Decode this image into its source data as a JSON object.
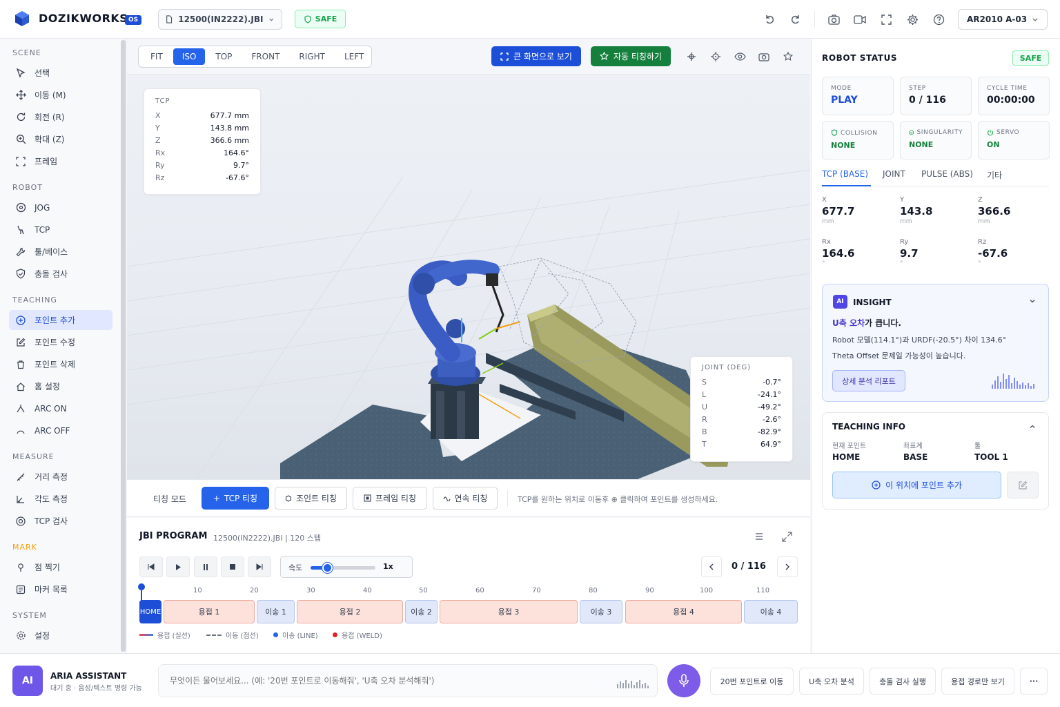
{
  "app": {
    "brand": "DOZIKWORKS",
    "os_badge": "OS",
    "file_name": "12500(IN2222).JBI",
    "safety": "SAFE",
    "robot_model": "AR2010 A-03"
  },
  "sidebar": {
    "sections": {
      "scene": "SCENE",
      "robot": "ROBOT",
      "teaching": "TEACHING",
      "measure": "MEASURE",
      "mark": "MARK",
      "system": "SYSTEM"
    },
    "scene_items": [
      "선택",
      "이동 (M)",
      "회전 (R)",
      "확대 (Z)",
      "프레임"
    ],
    "robot_items": [
      "JOG",
      "TCP",
      "툴/베이스",
      "충돌 검사"
    ],
    "teaching_items": [
      "포인트 추가",
      "포인트 수정",
      "포인트 삭제",
      "홈 설정",
      "ARC ON",
      "ARC OFF"
    ],
    "measure_items": [
      "거리 측정",
      "각도 측정",
      "TCP 검사"
    ],
    "mark_items": [
      "점 찍기",
      "마커 목록"
    ],
    "system_items": [
      "설정"
    ]
  },
  "viewport": {
    "view_tabs": [
      "FIT",
      "ISO",
      "TOP",
      "FRONT",
      "RIGHT",
      "LEFT"
    ],
    "active_view": "ISO",
    "fullscreen_label": "큰 화면으로 보기",
    "auto_teach_label": "자동 티칭하기",
    "tcp_card": {
      "title": "TCP",
      "rows": [
        {
          "k": "X",
          "v": "677.7 mm"
        },
        {
          "k": "Y",
          "v": "143.8 mm"
        },
        {
          "k": "Z",
          "v": "366.6 mm"
        },
        {
          "k": "Rx",
          "v": "164.6°"
        },
        {
          "k": "Ry",
          "v": "9.7°"
        },
        {
          "k": "Rz",
          "v": "-67.6°"
        }
      ]
    },
    "joint_card": {
      "title": "JOINT (DEG)",
      "rows": [
        {
          "k": "S",
          "v": "-0.7°"
        },
        {
          "k": "L",
          "v": "-24.1°"
        },
        {
          "k": "U",
          "v": "-49.2°"
        },
        {
          "k": "R",
          "v": "-2.6°"
        },
        {
          "k": "B",
          "v": "-82.9°"
        },
        {
          "k": "T",
          "v": "64.9°"
        }
      ]
    }
  },
  "teach_bar": {
    "label": "티칭 모드",
    "buttons": [
      "TCP 티칭",
      "조인트 티칭",
      "프레임 티칭",
      "연속 티칭"
    ],
    "hint": "TCP를 원하는 위치로 이동후 ⊕ 클릭하여 포인트를 생성하세요."
  },
  "program": {
    "title": "JBI PROGRAM",
    "subtitle": "12500(IN2222).JBI | 120 스텝",
    "speed_label": "속도",
    "speed_value": "1x",
    "speed_fraction": 0.25,
    "step_counter": "0 / 116",
    "ticks": [
      "10",
      "20",
      "30",
      "40",
      "50",
      "60",
      "70",
      "80",
      "90",
      "100",
      "110"
    ],
    "segments": [
      {
        "label": "HOME",
        "kind": "home"
      },
      {
        "label": "용접 1",
        "kind": "weld"
      },
      {
        "label": "이송 1",
        "kind": "move"
      },
      {
        "label": "용접 2",
        "kind": "weld"
      },
      {
        "label": "이송 2",
        "kind": "move"
      },
      {
        "label": "용접 3",
        "kind": "weld"
      },
      {
        "label": "이송 3",
        "kind": "move"
      },
      {
        "label": "용접 4",
        "kind": "weld"
      },
      {
        "label": "이송 4",
        "kind": "move"
      }
    ],
    "legend": [
      "용접 (실선)",
      "이동 (점선)",
      "이송 (LINE)",
      "용접 (WELD)"
    ]
  },
  "robot_status": {
    "title": "ROBOT STATUS",
    "safety": "SAFE",
    "mode_label": "MODE",
    "mode_value": "PLAY",
    "step_label": "STEP",
    "step_value": "0 / 116",
    "cycle_label": "CYCLE TIME",
    "cycle_value": "00:00:00",
    "collision_label": "COLLISION",
    "collision_value": "NONE",
    "singularity_label": "SINGULARITY",
    "singularity_value": "NONE",
    "servo_label": "SERVO",
    "servo_value": "ON",
    "tabs": [
      "TCP (BASE)",
      "JOINT",
      "PULSE (ABS)",
      "기타"
    ],
    "coords": [
      {
        "k": "X",
        "v": "677.7",
        "u": "mm"
      },
      {
        "k": "Y",
        "v": "143.8",
        "u": "mm"
      },
      {
        "k": "Z",
        "v": "366.6",
        "u": "mm"
      },
      {
        "k": "Rx",
        "v": "164.6",
        "u": "°"
      },
      {
        "k": "Ry",
        "v": "9.7",
        "u": "°"
      },
      {
        "k": "Rz",
        "v": "-67.6",
        "u": "°"
      }
    ]
  },
  "insight": {
    "badge": "AI",
    "title": "INSIGHT",
    "headline_hl": "U축 오차",
    "headline_rest": "가 큽니다.",
    "line1": "Robot 모델(114.1°)과 URDF(-20.5°) 차이 134.6°",
    "line2": "Theta Offset 문제일 가능성이 높습니다.",
    "button": "상세 분석 리포트"
  },
  "teaching_info": {
    "title": "TEACHING INFO",
    "current_point_label": "현재 포인트",
    "current_point": "HOME",
    "coord_system_label": "좌표계",
    "coord_system": "BASE",
    "tool_label": "툴",
    "tool": "TOOL 1",
    "add_button": "이 위치에 포인트 추가"
  },
  "assistant": {
    "avatar": "AI",
    "name": "ARIA ASSISTANT",
    "status": "대기 중 · 음성/텍스트 명령 가능",
    "placeholder": "무엇이든 물어보세요... (예: '20번 포인트로 이동해줘', 'U축 오차 분석해줘')",
    "quick_actions": [
      "20번 포인트로 이동",
      "U축 오차 분석",
      "충돌 검사 실행",
      "용접 경로만 보기"
    ],
    "more": "···"
  },
  "colors": {
    "primary": "#2563eb",
    "success": "#15803d",
    "weld_segment": "#fde2dc",
    "move_segment": "#e0e8f9",
    "ai_purple": "#6d56e8",
    "mark_orange": "#f59e0b"
  }
}
